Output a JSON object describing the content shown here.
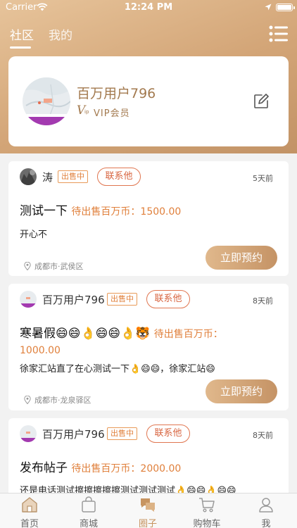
{
  "status_bar": {
    "carrier": "Carrier",
    "time": "12:24 PM"
  },
  "top_tabs": [
    {
      "label": "社区",
      "active": true
    },
    {
      "label": "我的",
      "active": false
    }
  ],
  "profile": {
    "name": "百万用户796",
    "vip_logo": "V",
    "vip_logo_sub": "ip",
    "vip_label": "VIP会员"
  },
  "posts": [
    {
      "user": "涛",
      "badge": "出售中",
      "contact": "联系他",
      "time": "5天前",
      "title": "测试一下",
      "price": "待出售百万币：1500.00",
      "desc": "开心不",
      "location": "成都市·武侯区",
      "action": "立即预约"
    },
    {
      "user": "百万用户796",
      "badge": "出售中",
      "contact": "联系他",
      "time": "8天前",
      "title": "寒暑假😄😄👌😄😄👌🐯",
      "price": "待出售百万币：1000.00",
      "desc": "徐家汇站直了在心测试一下👌😄😄，徐家汇站😄",
      "location": "成都市·龙泉驿区",
      "action": "立即预约"
    },
    {
      "user": "百万用户796",
      "badge": "出售中",
      "contact": "联系他",
      "time": "8天前",
      "title": "发布帖子",
      "price": "待出售百万币：2000.00",
      "desc": "还是电话测试擦擦擦擦擦测试测试测试👌😄😄👌😄😄"
    }
  ],
  "tabbar": [
    {
      "label": "首页",
      "icon": "home-icon",
      "active": false
    },
    {
      "label": "商城",
      "icon": "shopping-bag-icon",
      "active": false
    },
    {
      "label": "圈子",
      "icon": "chat-bubbles-icon",
      "active": true
    },
    {
      "label": "购物车",
      "icon": "cart-icon",
      "active": false
    },
    {
      "label": "我",
      "icon": "person-icon",
      "active": false
    }
  ],
  "colors": {
    "accent": "#c79460",
    "price": "#e0803c",
    "contact": "#d86540"
  }
}
